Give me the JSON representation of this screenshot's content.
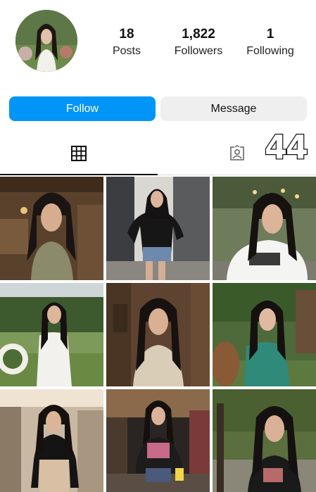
{
  "profile": {
    "stats": [
      {
        "value": "18",
        "label": "Posts"
      },
      {
        "value": "1,822",
        "label": "Followers"
      },
      {
        "value": "1",
        "label": "Following"
      }
    ]
  },
  "actions": {
    "follow_label": "Follow",
    "message_label": "Message"
  },
  "tabs": {
    "active": "grid",
    "items": [
      {
        "id": "grid",
        "icon": "grid-icon"
      },
      {
        "id": "tagged",
        "icon": "tagged-person-icon"
      }
    ]
  },
  "overlay": {
    "number": "44"
  },
  "posts": [
    {
      "id": 1,
      "scene": "rustic wooden barn, woman in olive shirt"
    },
    {
      "id": 2,
      "scene": "street, woman in black hoodie and denim shorts"
    },
    {
      "id": 3,
      "scene": "park with string lights, woman in white graphic tee"
    },
    {
      "id": 4,
      "scene": "garden lawn, woman in white long dress"
    },
    {
      "id": 5,
      "scene": "wooden cabin interior, woman in beige sweater"
    },
    {
      "id": 6,
      "scene": "forest garden with barrel, woman in teal dress"
    },
    {
      "id": 7,
      "scene": "shopping mall, woman in black crop top"
    },
    {
      "id": 8,
      "scene": "night street, woman in leather jacket holding bag"
    },
    {
      "id": 9,
      "scene": "autumn park path, woman in black jacket"
    }
  ],
  "colors": {
    "accent": "#0095f6",
    "secondary_button": "#efefef",
    "divider": "#dbdbdb"
  }
}
